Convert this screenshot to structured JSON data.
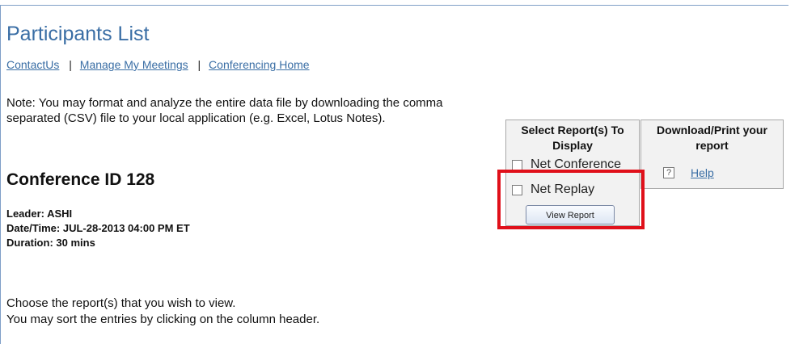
{
  "page": {
    "title": "Participants List"
  },
  "nav": {
    "links": [
      "ContactUs",
      "Manage My Meetings",
      "Conferencing Home"
    ],
    "separator": "|"
  },
  "note": "Note: You may format and analyze the entire data file by downloading the comma separated (CSV) file to your local application (e.g. Excel, Lotus Notes).",
  "conference": {
    "id_heading": "Conference ID 128",
    "leader": "Leader: ASHI",
    "datetime": "Date/Time: JUL-28-2013 04:00 PM ET",
    "duration": "Duration: 30 mins"
  },
  "instructions": {
    "line1": "Choose the report(s) that you wish to view.",
    "line2": "You may sort the entries by clicking on the column header."
  },
  "report_panel": {
    "title": "Select Report(s) To Display",
    "options": [
      {
        "label": "Net Conference",
        "checked": false
      },
      {
        "label": "Net Replay",
        "checked": false
      }
    ],
    "button": "View Report"
  },
  "download_panel": {
    "title": "Download/Print your report",
    "help_icon": "?",
    "help_link": "Help"
  },
  "colors": {
    "link": "#3a6ea5",
    "highlight": "#e0101a",
    "panel_bg": "#f2f2f2"
  }
}
